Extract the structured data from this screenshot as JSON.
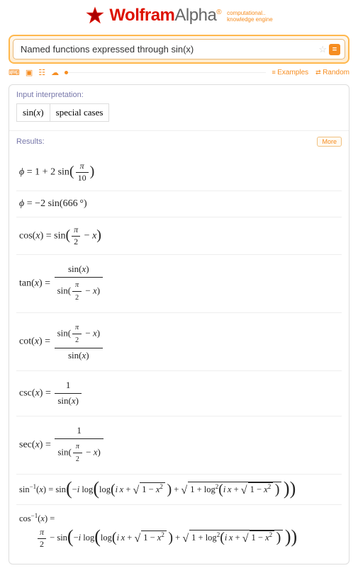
{
  "header": {
    "brand_wolfram": "Wolfram",
    "brand_alpha": "Alpha",
    "tagline_line1": "computational..",
    "tagline_line2": "knowledge engine"
  },
  "search": {
    "value": "Named functions expressed through sin(x)",
    "placeholder": ""
  },
  "toolbar": {
    "examples": "Examples",
    "random": "Random"
  },
  "interpretation": {
    "header": "Input interpretation:",
    "cell1_func": "sin",
    "cell1_arg": "x",
    "cell2": "special cases"
  },
  "results": {
    "header": "Results:",
    "more": "More",
    "phi": "ϕ",
    "eq": " = ",
    "plus": " + ",
    "minus": " − ",
    "neg": "−",
    "sin": "sin",
    "cos": "cos",
    "tan": "tan",
    "cot": "cot",
    "csc": "csc",
    "sec": "sec",
    "log": "log",
    "i": "i",
    "x": "x",
    "pi": "π",
    "deg": "°",
    "one": "1",
    "two": "2",
    "ten": "10",
    "n666": "666",
    "halfpi_num": "π",
    "halfpi_den": "2",
    "asin": "sin",
    "acos": "cos",
    "inv": "−1",
    "sq": "2"
  }
}
